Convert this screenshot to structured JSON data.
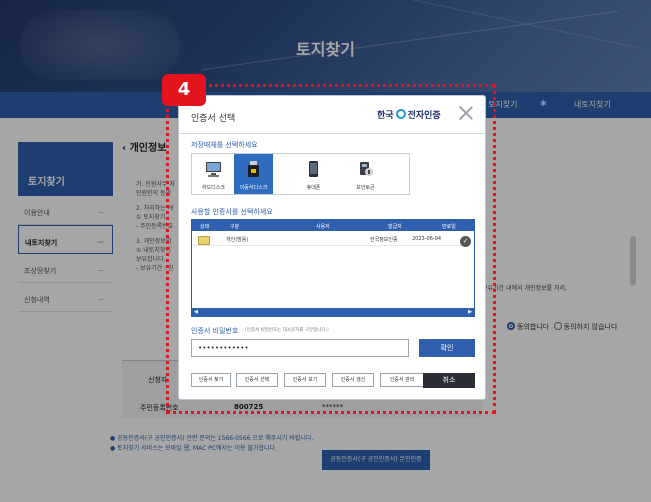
{
  "page": {
    "title": "토지찾기",
    "nav": [
      "토지찾기",
      "내토지찾기"
    ],
    "sidebar": {
      "title": "토지찾기",
      "items": [
        "이용안내",
        "내토지찾기",
        "조상땅찾기",
        "신청내역"
      ]
    },
    "section_title": "개인정보",
    "content_lines": [
      "가. 민원사무 처",
      "민원인의 동의",
      "2. 처리하는 개",
      "① 토지찾기 :",
      "- 주민등록번호",
      "3. 개인정보의",
      "① 내토지찾기",
      "보유합니다.",
      "- 보유기간 : 민"
    ],
    "right_note": "보유기간 내에서 개인정보를 처리,",
    "agree_label": "동의합니다",
    "disagree_label": "동의하지 않습니다",
    "table_labels": [
      "신청자",
      "주민등록번호"
    ],
    "table_value": "800725",
    "table_masked": "******",
    "footer_notes": [
      "공동인증서(구 공인인증서) 관련 문의는 1566-0566 으로 해주시기 바랍니다.",
      "토지찾기 서비스는 모바일 웹, MAC PC에서는 이용 불가합니다."
    ],
    "footer_button": "공동인증서(구 공인인증서) 본인인증"
  },
  "step_badge": "4",
  "modal": {
    "title": "인증서 선택",
    "brand": [
      "한국",
      "전자인증"
    ],
    "storage_label": "저장매체를 선택하세요",
    "media": [
      {
        "label": "하드디스크",
        "icon": "hard-disk-icon",
        "selected": false
      },
      {
        "label": "이동식디스크",
        "icon": "usb-drive-icon",
        "selected": true
      },
      {
        "label": "휴대폰",
        "icon": "mobile-phone-icon",
        "selected": false
      },
      {
        "label": "보안토큰",
        "icon": "security-token-icon",
        "selected": false
      }
    ],
    "cert_label": "사용할 인증서를 선택하세요",
    "columns": [
      "상태",
      "구분",
      "사용자",
      "발급자",
      "만료일"
    ],
    "certs": [
      {
        "type": "개인(범용)",
        "user": "",
        "issuer": "한국정보인증",
        "expiry": "2023-06-04"
      }
    ],
    "password_label": "인증서 비밀번호",
    "password_hint": "(인증서 비밀번호는 대소문자를 구분합니다.)",
    "password_value": "••••••••••••",
    "confirm": "확인",
    "buttons": [
      "인증서 찾기",
      "인증서 선택",
      "인증서 보기",
      "인증서 갱신",
      "인증서 관리"
    ],
    "cancel": "취소"
  },
  "colors": {
    "accent": "#2f5fae",
    "highlight": "#e3141e",
    "cancel": "#2b2e35"
  }
}
